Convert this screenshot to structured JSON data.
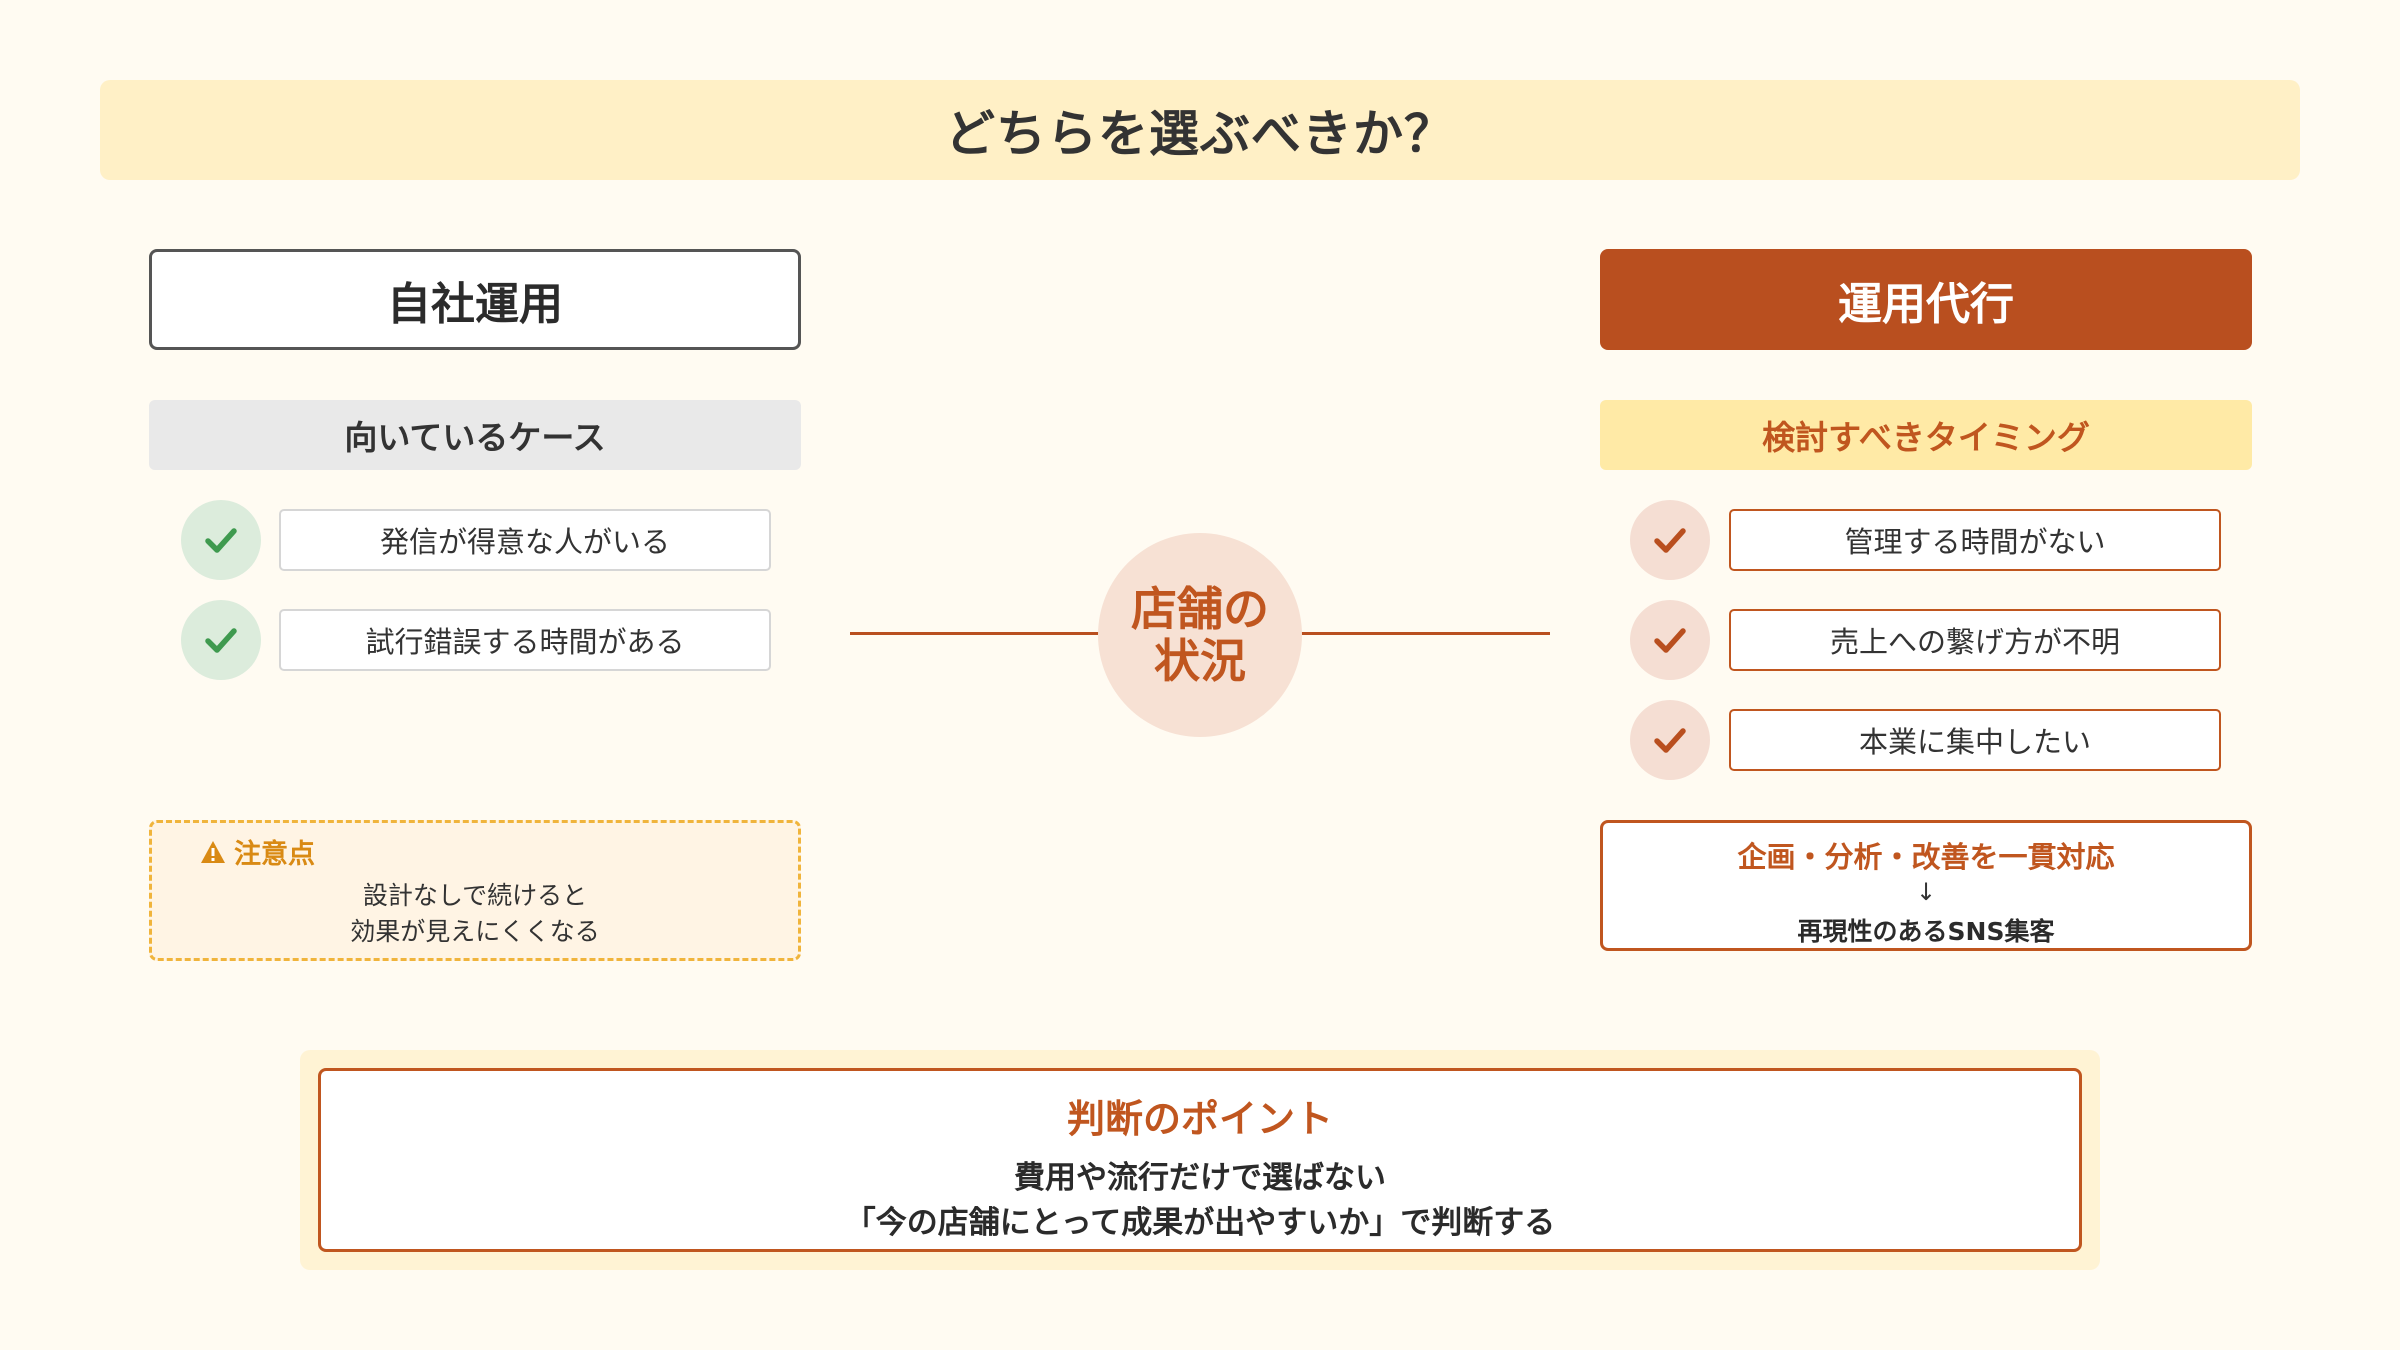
{
  "title": "どちらを選ぶべきか？",
  "left": {
    "heading": "自社運用",
    "subheading": "向いているケース",
    "items": [
      "発信が得意な人がいる",
      "試行錯誤する時間がある"
    ],
    "caution": {
      "title": "注意点",
      "lines": [
        "設計なしで続けると",
        "効果が見えにくくなる"
      ]
    }
  },
  "center": {
    "lines": [
      "店舗の",
      "状況"
    ]
  },
  "right": {
    "heading": "運用代行",
    "subheading": "検討すべきタイミング",
    "items": [
      "管理する時間がない",
      "売上への繋げ方が不明",
      "本業に集中したい"
    ],
    "summary": {
      "line1": "企画・分析・改善を一貫対応",
      "arrow": "↓",
      "line2": "再現性のあるSNS集客"
    }
  },
  "point": {
    "title": "判断のポイント",
    "lines": [
      "費用や流行だけで選ばない",
      "「今の店舗にとって成果が出やすいか」で判断する"
    ]
  },
  "colors": {
    "accent": "#b94f1f",
    "accent_text": "#c0561f",
    "check_green": "#3f9a4f",
    "caution": "#d98a14",
    "background": "#fffbf2"
  }
}
